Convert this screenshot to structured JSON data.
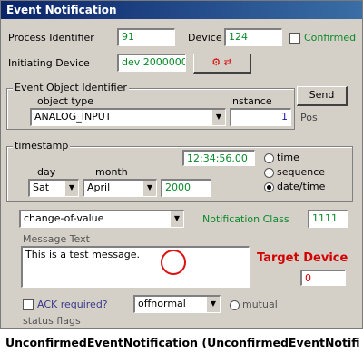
{
  "window": {
    "title": "Event Notification"
  },
  "header": {
    "process_id_label": "Process Identifier",
    "process_id_value": "91",
    "unit_label": "Device",
    "unit_value": "124",
    "confirmed_label": "Confirmed",
    "initiating_device_label": "Initiating Device",
    "initiating_device_value": "dev 2000000",
    "send_button": "Send"
  },
  "event_object": {
    "group_title": "Event Object Identifier",
    "object_type_label": "object type",
    "instance_label": "instance",
    "object_type_value": "ANALOG_INPUT",
    "instance_value": "1",
    "pos_label": "Pos"
  },
  "timestamp": {
    "group_title": "timestamp",
    "time_value": "12:34:56.00",
    "day_label": "day",
    "month_label": "month",
    "year_value": "2000",
    "day_value": "Sat",
    "month_value": "April",
    "time_radio_label": "time",
    "sequence_radio_label": "sequence",
    "date_radio_label": "date/time"
  },
  "event_row": {
    "event_type_value": "change-of-value",
    "notification_class_label": "Notification Class",
    "notification_class_value": "1111"
  },
  "message": {
    "label": "Message Text",
    "text": "This is a test message."
  },
  "target": {
    "label": "Target Device",
    "value": "0"
  },
  "options": {
    "ack_label": "ACK required?",
    "notify_type_value": "offnormal",
    "mutual_label": "mutual",
    "status_flags_label": "status flags"
  },
  "caption": "UnconfirmedEventNotification (UnconfirmedEventNotification)..."
}
